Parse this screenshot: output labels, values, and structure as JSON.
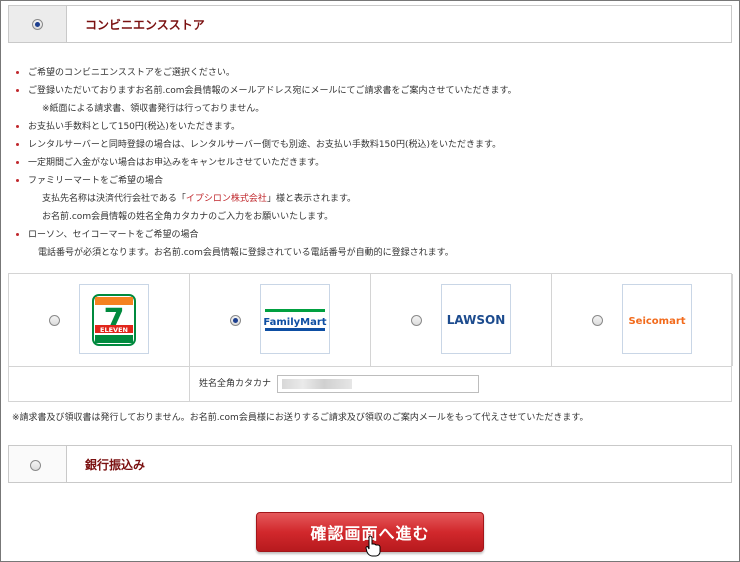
{
  "convenience": {
    "title": "コンビニエンスストア",
    "selected": true
  },
  "notes": [
    {
      "text": "ご希望のコンビニエンスストアをご選択ください。",
      "bullet": true
    },
    {
      "text": "ご登録いただいておりますお名前.com会員情報のメールアドレス宛にメールにてご請求書をご案内させていただきます。",
      "bullet": true
    },
    {
      "text": "※紙面による請求書、領収書発行は行っておりません。",
      "bullet": false
    },
    {
      "text": "お支払い手数料として150円(税込)をいただきます。",
      "bullet": true
    },
    {
      "text": "レンタルサーバーと同時登録の場合は、レンタルサーバー側でも別途、お支払い手数料150円(税込)をいただきます。",
      "bullet": true
    },
    {
      "text": "一定期間ご入金がない場合はお申込みをキャンセルさせていただきます。",
      "bullet": true
    },
    {
      "text": "ファミリーマートをご希望の場合",
      "bullet": true
    },
    {
      "text_pre": "支払先名称は決済代行会社である「",
      "link": "イプシロン株式会社",
      "text_post": "」様と表示されます。",
      "bullet": false
    },
    {
      "text": "お名前.com会員情報の姓名全角カタカナのご入力をお願いいたします。",
      "bullet": false
    },
    {
      "text": "ローソン、セイコーマートをご希望の場合",
      "bullet": true
    },
    {
      "text": "電話番号が必須となります。お名前.com会員情報に登録されている電話番号が自動的に登録されます。",
      "bullet": false
    }
  ],
  "stores": [
    {
      "name": "7-Eleven",
      "logo_text": "ELEVEN",
      "selected": false
    },
    {
      "name": "FamilyMart",
      "logo_text": "FamilyMart",
      "selected": true
    },
    {
      "name": "LAWSON",
      "logo_text": "LAWSON",
      "selected": false
    },
    {
      "name": "Seicomart",
      "logo_text": "Seicomart",
      "selected": false
    }
  ],
  "kana": {
    "label": "姓名全角カタカナ",
    "value": ""
  },
  "receipt_note": "※請求書及び領収書は発行しておりません。お名前.com会員様にお送りするご請求及び領収のご案内メールをもって代えさせていただきます。",
  "bank": {
    "title": "銀行振込み",
    "selected": false
  },
  "confirm_button": "確認画面へ進む",
  "colors": {
    "accent_red": "#c0282d",
    "title_red": "#7a1010",
    "familymart_green": "#00a040",
    "familymart_blue": "#0d4ea3",
    "lawson_blue": "#1c4b8e",
    "seicomart_orange": "#f26a1b"
  }
}
